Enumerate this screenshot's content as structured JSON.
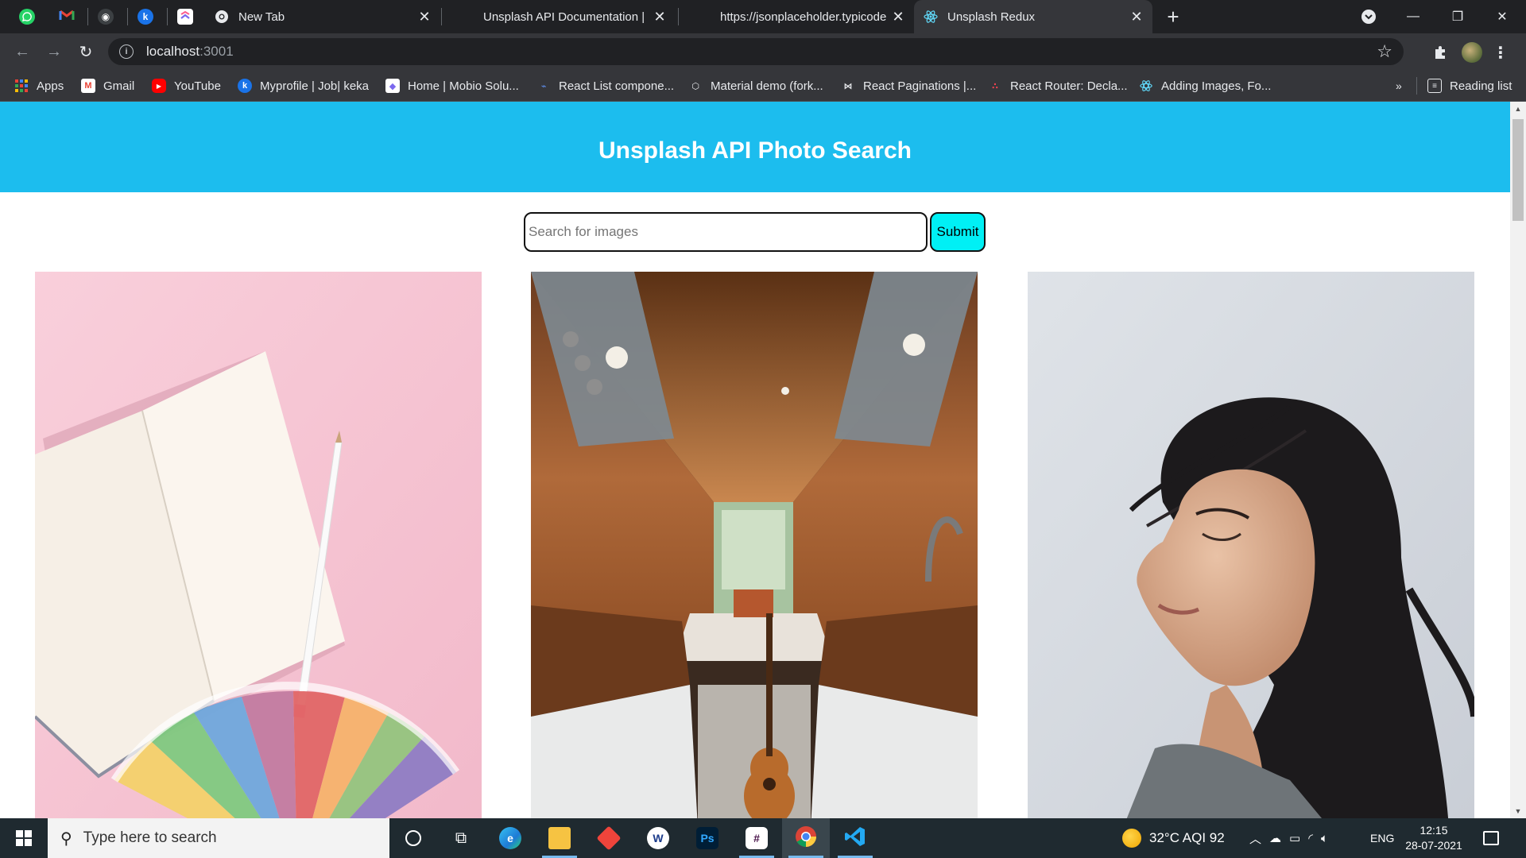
{
  "browser": {
    "tabs": [
      {
        "title": "New Tab",
        "active": false
      },
      {
        "title": "Unsplash API Documentation | Fr",
        "active": false
      },
      {
        "title": "https://jsonplaceholder.typicode.",
        "active": false
      },
      {
        "title": "Unsplash Redux",
        "active": true
      }
    ],
    "address": {
      "host": "localhost",
      "port": ":3001"
    },
    "bookmarks": [
      {
        "label": "Apps"
      },
      {
        "label": "Gmail"
      },
      {
        "label": "YouTube"
      },
      {
        "label": "Myprofile | Job| keka"
      },
      {
        "label": "Home | Mobio Solu..."
      },
      {
        "label": "React List compone..."
      },
      {
        "label": "Material demo (fork..."
      },
      {
        "label": "React Paginations |..."
      },
      {
        "label": "React Router: Decla..."
      },
      {
        "label": "Adding Images, Fo..."
      }
    ],
    "bookmarks_overflow": "»",
    "reading_list": "Reading list"
  },
  "page": {
    "header_title": "Unsplash API Photo Search",
    "search_placeholder": "Search for images",
    "search_value": "",
    "submit_label": "Submit",
    "photos": [
      {
        "subject": "Open notebook with pencil and color swatch fan on pink background"
      },
      {
        "subject": "Camper van interior with wooden walls and a guitar"
      },
      {
        "subject": "Woman with flowing dark hair, eyes closed, against a cloudy sky"
      }
    ]
  },
  "taskbar": {
    "search_placeholder": "Type here to search",
    "weather": "32°C  AQI 92",
    "language": "ENG",
    "time": "12:15",
    "date": "28-07-2021"
  },
  "colors": {
    "header_bg": "#1cbdee",
    "submit_bg": "#00f0f5",
    "browser_dark": "#202124",
    "browser_toolbar": "#35363a"
  }
}
